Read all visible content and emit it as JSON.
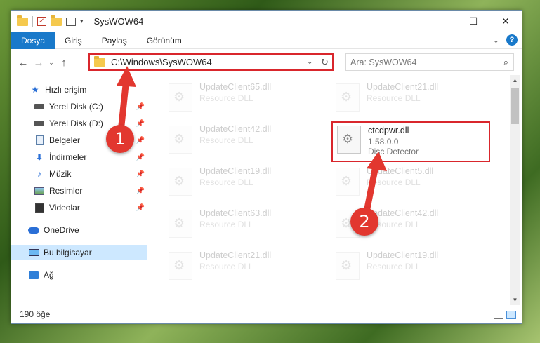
{
  "window": {
    "title": "SysWOW64"
  },
  "ribbon": {
    "tabs": [
      "Dosya",
      "Giriş",
      "Paylaş",
      "Görünüm"
    ]
  },
  "address": {
    "path": "C:\\Windows\\SysWOW64"
  },
  "search": {
    "placeholder": "Ara: SysWOW64"
  },
  "nav": {
    "quick_access": "Hızlı erişim",
    "items": [
      "Yerel Disk (C:)",
      "Yerel Disk (D:)",
      "Belgeler",
      "İndirmeler",
      "Müzik",
      "Resimler",
      "Videolar"
    ],
    "onedrive": "OneDrive",
    "this_pc": "Bu bilgisayar",
    "network": "Ağ"
  },
  "files": [
    {
      "name": "UpdateClient65.dll",
      "type": "Resource DLL"
    },
    {
      "name": "UpdateClient21.dll",
      "type": "Resource DLL"
    },
    {
      "name": "UpdateClient42.dll",
      "type": "Resource DLL"
    },
    {
      "name": "ctcdpwr.dll",
      "version": "1.58.0.0",
      "type": "Disc Detector"
    },
    {
      "name": "UpdateClient19.dll",
      "type": "Resource DLL"
    },
    {
      "name": "UpdateClient5.dll",
      "type": "Resource DLL"
    },
    {
      "name": "UpdateClient63.dll",
      "type": "Resource DLL"
    },
    {
      "name": "UpdateClient42.dll",
      "type": "Resource DLL"
    },
    {
      "name": "UpdateClient21.dll",
      "type": "Resource DLL"
    },
    {
      "name": "UpdateClient19.dll",
      "type": "Resource DLL"
    }
  ],
  "status": {
    "count": "190 öğe"
  },
  "callouts": [
    "1",
    "2"
  ],
  "colors": {
    "accent": "#1979ca",
    "highlight": "#d9262c",
    "callout": "#e2372f"
  }
}
